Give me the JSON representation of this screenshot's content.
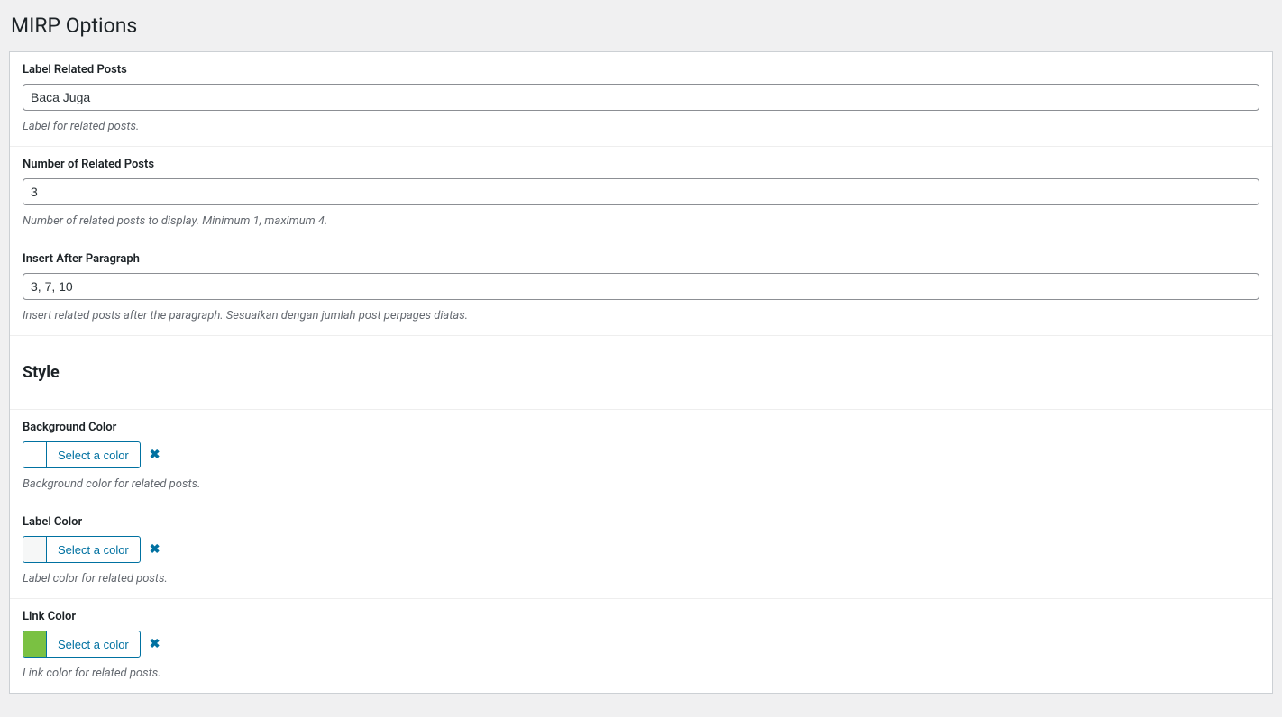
{
  "page": {
    "title": "MIRP Options"
  },
  "fields": {
    "label_related_posts": {
      "label": "Label Related Posts",
      "value": "Baca Juga",
      "description": "Label for related posts."
    },
    "number_related_posts": {
      "label": "Number of Related Posts",
      "value": "3",
      "description": "Number of related posts to display. Minimum 1, maximum 4."
    },
    "insert_after_paragraph": {
      "label": "Insert After Paragraph",
      "value": "3, 7, 10",
      "description": "Insert related posts after the paragraph. Sesuaikan dengan jumlah post perpages diatas."
    }
  },
  "style_section": {
    "title": "Style",
    "select_color_label": "Select a color",
    "background_color": {
      "label": "Background Color",
      "value": "#000000",
      "description": "Background color for related posts."
    },
    "label_color": {
      "label": "Label Color",
      "value": "#f6f7f7",
      "description": "Label color for related posts."
    },
    "link_color": {
      "label": "Link Color",
      "value": "#7ac142",
      "description": "Link color for related posts."
    }
  }
}
